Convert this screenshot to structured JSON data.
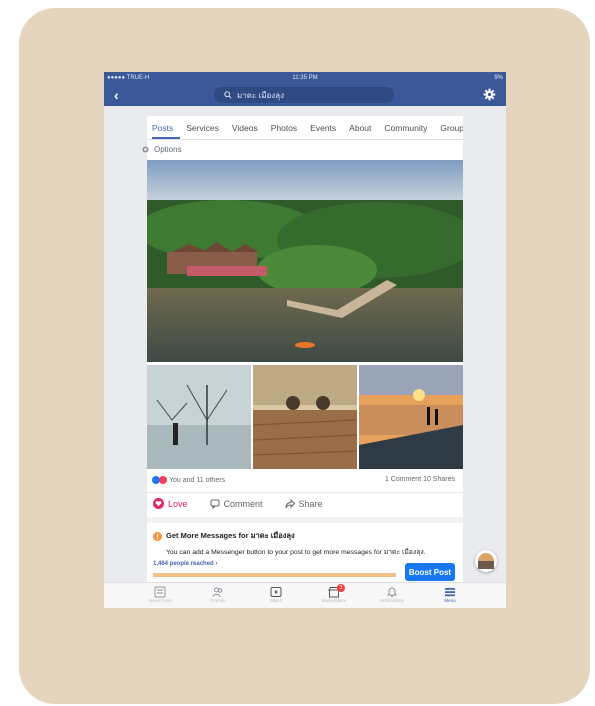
{
  "status": {
    "carrier": "●●●●● TRUE-H",
    "time": "11:35 PM",
    "battery": "9%"
  },
  "nav": {
    "search_text": "มาดะ เมืองลุง"
  },
  "tabs": [
    "Posts",
    "Services",
    "Videos",
    "Photos",
    "Events",
    "About",
    "Community",
    "Group"
  ],
  "options_label": "Options",
  "post": {
    "reactions_text": "You and 11 others",
    "comments_text": "1 Comment",
    "shares_text": "10 Shares",
    "actions": {
      "love": "Love",
      "comment": "Comment",
      "share": "Share"
    }
  },
  "messenger": {
    "title": "Get More Messages for มาดะ เมืองลุง",
    "subtitle": "You can add a Messenger button to your post to get more messages for มาดะ เมืองลุง."
  },
  "reach": {
    "text": "1,464 people reached ›",
    "boost_label": "Boost Post"
  },
  "tabbar": [
    {
      "label": "News Feed",
      "icon": "news-feed-icon"
    },
    {
      "label": "Friends",
      "icon": "friends-icon"
    },
    {
      "label": "Watch",
      "icon": "watch-icon"
    },
    {
      "label": "Marketplace",
      "icon": "marketplace-icon",
      "badge": "3"
    },
    {
      "label": "Notifications",
      "icon": "bell-icon"
    },
    {
      "label": "Menu",
      "icon": "menu-icon"
    }
  ],
  "colors": {
    "brand": "#3b5998",
    "accent": "#1877f2",
    "love": "#e0245e",
    "card_bg": "#e5d5bf"
  }
}
